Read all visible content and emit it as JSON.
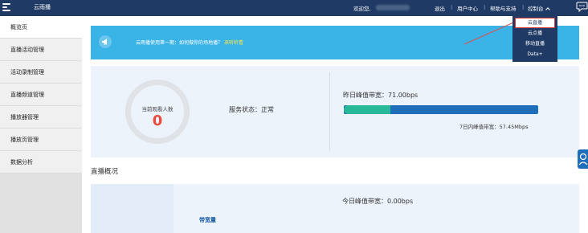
{
  "topbar": {
    "app_title": "云雨播",
    "welcome": "欢迎您,",
    "nav": {
      "logout": "退出",
      "user_center": "用户中心",
      "help": "帮助与支持",
      "console": "控制台"
    },
    "separator": "|"
  },
  "dropdown": {
    "items": [
      "云直播",
      "云点播",
      "移动直播",
      "Data+"
    ]
  },
  "sidebar": {
    "items": [
      "概览页",
      "直播活动管理",
      "活动录制管理",
      "直播频道管理",
      "播放器管理",
      "播放页管理",
      "数据分析"
    ]
  },
  "notice": {
    "text": "云雨播使用第一期：如何做你的场地播？",
    "link": "来听听看",
    "right": "更多"
  },
  "stats": {
    "ring_label": "当前观看人数",
    "ring_value": "0",
    "service_status": "服务状态：正常",
    "yesterday_peak": "昨日峰值带宽：71.00bps",
    "bar_fraction": 0.24,
    "seven_day_peak": "7日内峰值带宽：57.45Mbps"
  },
  "overview": {
    "section_title": "直播概况",
    "bandwidth_link": "带宽量",
    "today_peak": "今日峰值带宽：0.00bps"
  },
  "colors": {
    "topbar": "#1f3a64",
    "notice": "#3ab3e6",
    "bar_track": "#1f6eba",
    "bar_fill": "#2ab89b",
    "ring_value": "#e74c3c"
  }
}
